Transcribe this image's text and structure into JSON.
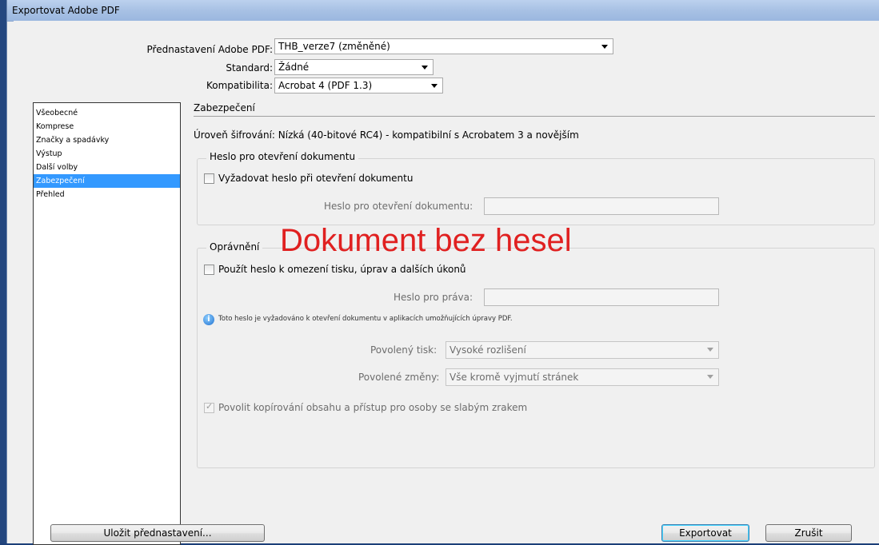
{
  "window": {
    "title": "Exportovat Adobe PDF"
  },
  "header": {
    "preset_label": "Přednastavení Adobe PDF:",
    "preset_value": "THB_verze7 (změněné)",
    "standard_label": "Standard:",
    "standard_value": "Žádné",
    "compat_label": "Kompatibilita:",
    "compat_value": "Acrobat 4 (PDF 1.3)"
  },
  "sidebar": {
    "items": [
      {
        "label": "Všeobecné"
      },
      {
        "label": "Komprese"
      },
      {
        "label": "Značky a spadávky"
      },
      {
        "label": "Výstup"
      },
      {
        "label": "Další volby"
      },
      {
        "label": "Zabezpečení",
        "selected": true
      },
      {
        "label": "Přehled"
      }
    ]
  },
  "main": {
    "section_title": "Zabezpečení",
    "encryption_text": "Úroveň šifrování: Nízká (40-bitové RC4) - kompatibilní s Acrobatem 3 a novějším",
    "open_group": {
      "legend": "Heslo pro otevření dokumentu",
      "checkbox_label": "Vyžadovat heslo při otevření dokumentu",
      "field_label": "Heslo pro otevření dokumentu:",
      "checked": false
    },
    "perm_group": {
      "legend": "Oprávnění",
      "checkbox_label": "Použít heslo k omezení tisku, úprav a dalších úkonů",
      "field_label": "Heslo pro práva:",
      "info_note": "Toto heslo je vyžadováno k otevření dokumentu v aplikacích umožňujících úpravy PDF.",
      "print_label": "Povolený tisk:",
      "print_value": "Vysoké rozlišení",
      "changes_label": "Povolené změny:",
      "changes_value": "Vše kromě vyjmutí stránek",
      "copy_label": "Povolit kopírování obsahu a přístup pro osoby se slabým zrakem",
      "copy_checked": true
    }
  },
  "overlay": {
    "text": "Dokument bez hesel",
    "color": "#e02020"
  },
  "footer": {
    "save_preset_label": "Uložit přednastavení...",
    "export_label": "Exportovat",
    "cancel_label": "Zrušit"
  }
}
